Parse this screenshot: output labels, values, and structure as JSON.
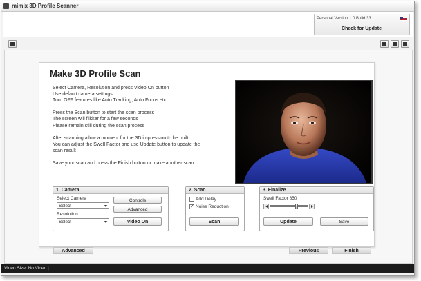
{
  "window": {
    "title": "mimix 3D Profile Scanner"
  },
  "topbar": {
    "version": "Personal Version 1.0  Build 33",
    "check_update": "Check for Update",
    "flag_icon": "us-flag-icon"
  },
  "card": {
    "title": "Make 3D Profile Scan",
    "instructions": [
      "Select Camera, Resolution and press Video On button",
      "Use default camera settings",
      "Turn OFF features like Auto Tracking, Auto Focus etc",
      "",
      "Press the Scan button to start the scan process",
      "The screen will flikker for a few seconds",
      "Please remain still during the scan process",
      "",
      "After scanning allow a moment for the 3D impression to be built",
      "You can adjust the Swell Factor and use Update button to update the",
      "scan result",
      "",
      "Save your scan and press the Finish button or make another scan"
    ]
  },
  "camera": {
    "title": "1. Camera",
    "select_camera_label": "Select Camera",
    "select_camera_value": "Select",
    "resolution_label": "Resolution",
    "resolution_value": "Select",
    "controls": "Controls",
    "advanced": "Advanced",
    "video_on": "Video On"
  },
  "scan": {
    "title": "2. Scan",
    "add_delay": "Add Delay",
    "add_delay_checked": false,
    "noise_reduction": "Noise Reduction",
    "noise_reduction_checked": true,
    "scan_button": "Scan"
  },
  "finalize": {
    "title": "3. Finalize",
    "swell_label": "Swell Factor 850",
    "swell_value": 0.72,
    "update_button": "Update",
    "save_button": "Save"
  },
  "footer_buttons": {
    "advanced": "Advanced",
    "previous": "Previous",
    "finish": "Finish"
  },
  "status": {
    "text": "Video Size: No Video |"
  },
  "colors": {
    "status_bg": "#1c1c1c",
    "shirt": "#2a3fb0"
  }
}
